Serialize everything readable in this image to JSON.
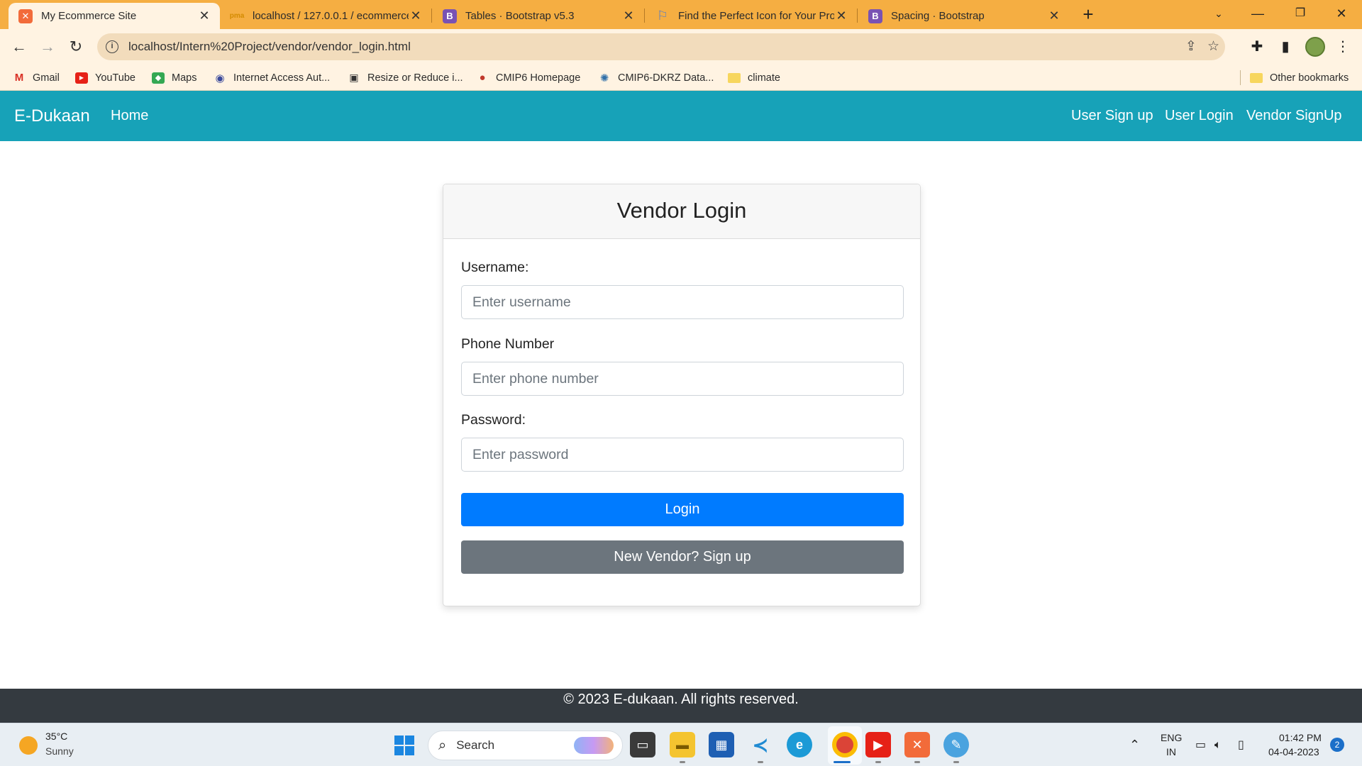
{
  "browser": {
    "tabs": [
      {
        "title": "My Ecommerce Site",
        "icon": "xampp-icon",
        "active": true
      },
      {
        "title": "localhost / 127.0.0.1 / ecommerce",
        "icon": "phpmyadmin-icon",
        "active": false
      },
      {
        "title": "Tables · Bootstrap v5.3",
        "icon": "bootstrap-icon",
        "active": false
      },
      {
        "title": "Find the Perfect Icon for Your Pro",
        "icon": "flag-icon",
        "active": false
      },
      {
        "title": "Spacing · Bootstrap",
        "icon": "bootstrap-icon",
        "active": false
      }
    ],
    "address": "localhost/Intern%20Project/vendor/vendor_login.html",
    "bookmarks": [
      {
        "label": "Gmail",
        "icon": "gmail-icon"
      },
      {
        "label": "YouTube",
        "icon": "youtube-icon"
      },
      {
        "label": "Maps",
        "icon": "maps-icon"
      },
      {
        "label": "Internet Access Aut...",
        "icon": "globe-icon"
      },
      {
        "label": "Resize or Reduce i...",
        "icon": "resize-icon"
      },
      {
        "label": "CMIP6 Homepage",
        "icon": "cmip-icon"
      },
      {
        "label": "CMIP6-DKRZ Data...",
        "icon": "dkrz-icon"
      },
      {
        "label": "climate",
        "icon": "folder-icon"
      }
    ],
    "other_bookmarks": "Other bookmarks"
  },
  "site": {
    "brand": "E-Dukaan",
    "nav_left": [
      "Home"
    ],
    "nav_right": [
      "User Sign up",
      "User Login",
      "Vendor SignUp"
    ]
  },
  "login": {
    "title": "Vendor Login",
    "username_label": "Username:",
    "username_placeholder": "Enter username",
    "phone_label": "Phone Number",
    "phone_placeholder": "Enter phone number",
    "password_label": "Password:",
    "password_placeholder": "Enter password",
    "login_button": "Login",
    "signup_button": "New Vendor? Sign up"
  },
  "footer": {
    "text": "© 2023 E-dukaan. All rights reserved."
  },
  "taskbar": {
    "weather_temp": "35°C",
    "weather_desc": "Sunny",
    "search_label": "Search",
    "lang_line1": "ENG",
    "lang_line2": "IN",
    "time": "01:42 PM",
    "date": "04-04-2023",
    "notifications": "2"
  },
  "colors": {
    "navbar": "#17a2b8",
    "primary_button": "#007bff",
    "secondary_button": "#6c757d",
    "footer": "#343a40",
    "tabstrip": "#f5ae42"
  }
}
